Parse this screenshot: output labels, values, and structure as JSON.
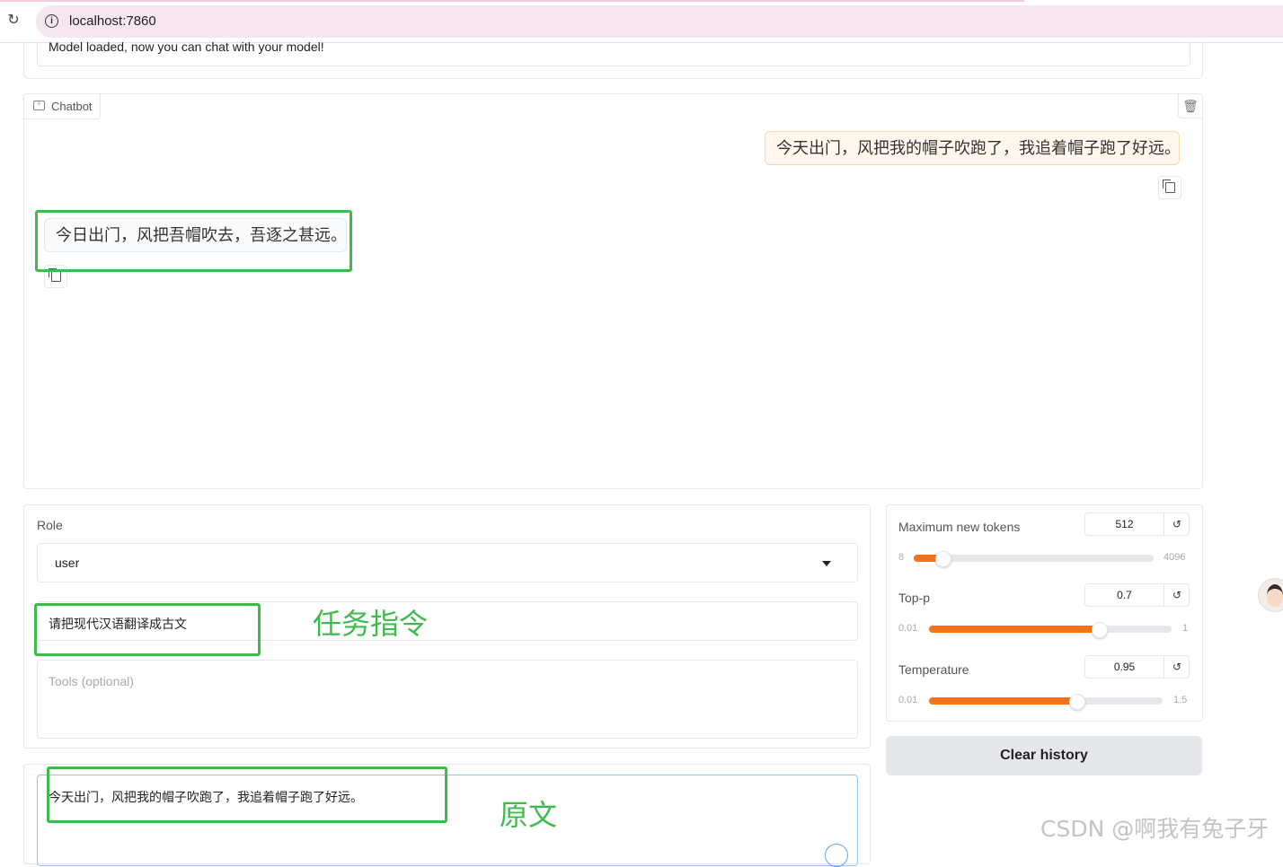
{
  "browser": {
    "url": "localhost:7860"
  },
  "status": {
    "text": "Model loaded, now you can chat with your model!"
  },
  "chatbot": {
    "label": "Chatbot",
    "messages": [
      {
        "role": "user",
        "text": "今天出门，风把我的帽子吹跑了，我追着帽子跑了好远。"
      },
      {
        "role": "assistant",
        "text": "今日出门，风把吾帽吹去，吾逐之甚远。"
      }
    ]
  },
  "role": {
    "label": "Role",
    "value": "user"
  },
  "system_prompt": {
    "value": "请把现代汉语翻译成古文"
  },
  "tools": {
    "placeholder": "Tools (optional)"
  },
  "query": {
    "value": "今天出门，风把我的帽子吹跑了，我追着帽子跑了好远。"
  },
  "sliders": [
    {
      "label": "Maximum new tokens",
      "value": "512",
      "min": "8",
      "max": "4096",
      "fraction": 0.12
    },
    {
      "label": "Top-p",
      "value": "0.7",
      "min": "0.01",
      "max": "1",
      "fraction": 0.7
    },
    {
      "label": "Temperature",
      "value": "0.95",
      "min": "0.01",
      "max": "1.5",
      "fraction": 0.63
    }
  ],
  "reset_symbol": "↺",
  "clear_button": "Clear history",
  "annotations": {
    "instruction": "任务指令",
    "source": "原文"
  },
  "watermark": "CSDN @啊我有兔子牙",
  "colors": {
    "accent": "#f97316",
    "annotation": "#3dbb4b",
    "user_bubble": "#fff7ed"
  }
}
